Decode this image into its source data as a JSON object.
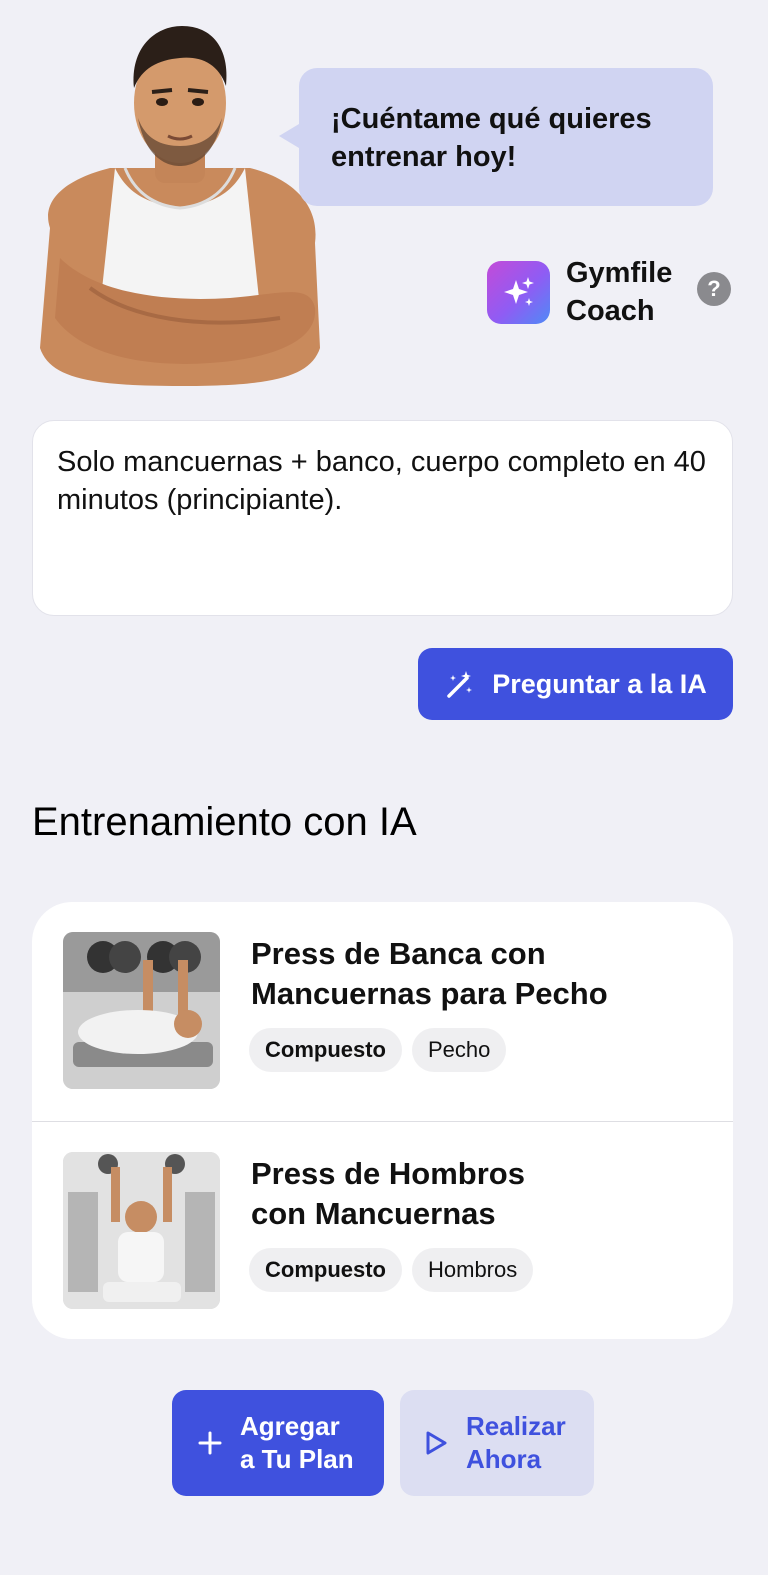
{
  "coach": {
    "bubble_text": "¡Cuéntame qué quieres entrenar hoy!",
    "brand_name": "Gymfile Coach",
    "help_glyph": "?",
    "logo_icon": "sparkles-icon"
  },
  "prompt": {
    "value": "Solo mancuernas + banco, cuerpo completo en 40 minutos (principiante)."
  },
  "ask_button": {
    "label": "Preguntar a la IA",
    "icon": "magic-wand-icon"
  },
  "section": {
    "title": "Entrenamiento con IA"
  },
  "exercises": [
    {
      "title": "Press de Banca con Mancuernas para Pecho",
      "tags": [
        "Compuesto",
        "Pecho"
      ]
    },
    {
      "title": "Press de Hombros con Mancuernas",
      "tags": [
        "Compuesto",
        "Hombros"
      ]
    }
  ],
  "actions": {
    "add_plan": "Agregar\na Tu Plan",
    "do_now": "Realizar\nAhora"
  },
  "colors": {
    "accent": "#3f51de",
    "bubble": "#d0d4f2",
    "background": "#f0f0f6"
  }
}
